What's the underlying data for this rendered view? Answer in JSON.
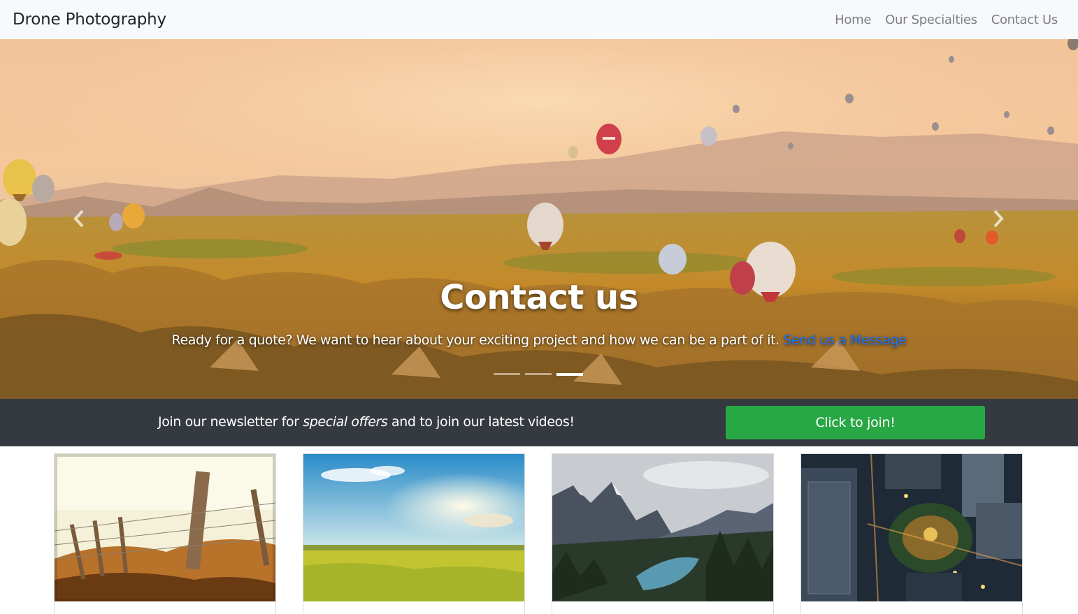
{
  "navbar": {
    "brand": "Drone Photography",
    "links": [
      "Home",
      "Our Specialties",
      "Contact Us"
    ]
  },
  "hero": {
    "title": "Contact us",
    "text": "Ready for a quote? We want to hear about your exciting project and how we can be a part of it.",
    "link_text": "Send us a Message",
    "slides_total": 3,
    "active_slide": 3
  },
  "newsletter": {
    "text_before": "Join our newsletter for ",
    "text_emphasis": "special offers",
    "text_after": " and to join our latest videos!",
    "button_label": "Click to join!",
    "button_color": "#28a745"
  },
  "cards": [
    {
      "image": "fence-field-photo"
    },
    {
      "image": "sunny-meadow-photo"
    },
    {
      "image": "mountain-lake-photo"
    },
    {
      "image": "city-aerial-photo"
    }
  ]
}
